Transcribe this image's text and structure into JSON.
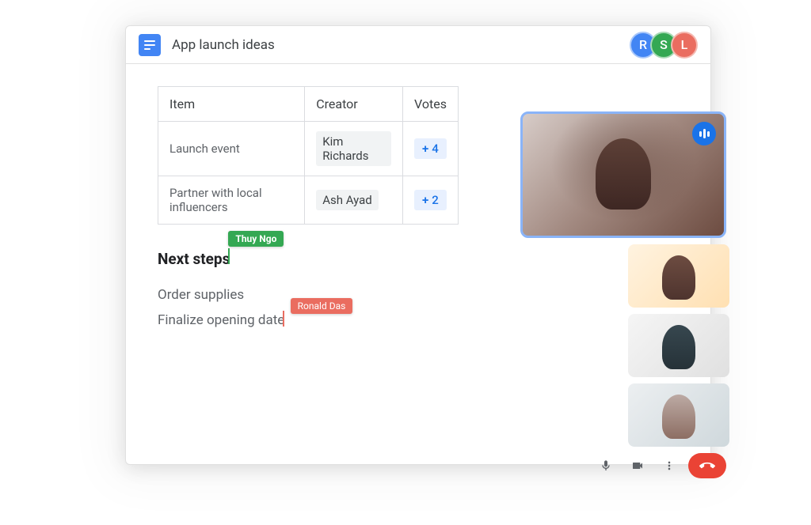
{
  "title": "App launch ideas",
  "collaborators": [
    {
      "initial": "R",
      "class": "av-r"
    },
    {
      "initial": "S",
      "class": "av-s"
    },
    {
      "initial": "L",
      "class": "av-l"
    }
  ],
  "table": {
    "headers": {
      "item": "Item",
      "creator": "Creator",
      "votes": "Votes"
    },
    "rows": [
      {
        "item": "Launch event",
        "creator": "Kim Richards",
        "votes": "4"
      },
      {
        "item": "Partner with local influencers",
        "creator": "Ash Ayad",
        "votes": "2"
      }
    ]
  },
  "next_steps": {
    "heading": "Next steps",
    "items": [
      "Order supplies",
      "Finalize opening date"
    ]
  },
  "cursors": {
    "thuy": "Thuy Ngo",
    "ronald": "Ronald Das"
  }
}
